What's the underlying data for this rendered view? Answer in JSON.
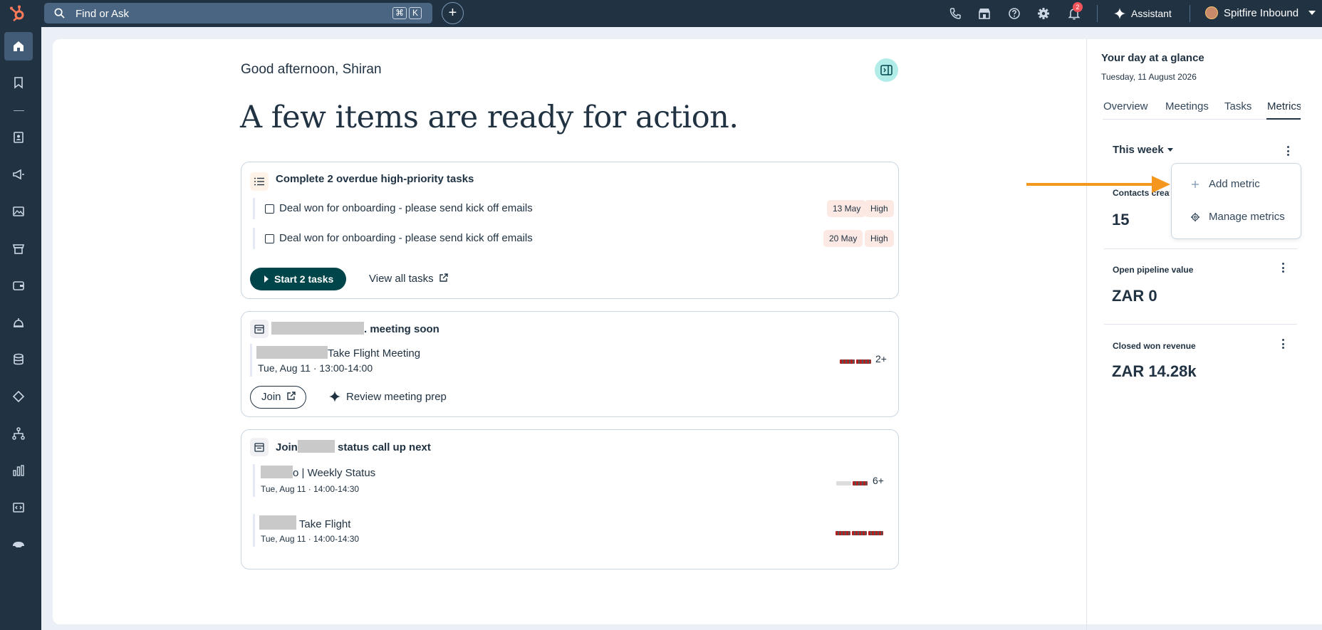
{
  "topbar": {
    "search_placeholder": "Find or Ask",
    "shortcut_keys": [
      "⌘",
      "K"
    ],
    "notification_count": "2",
    "assistant_label": "Assistant",
    "account_name": "Spitfire Inbound"
  },
  "main": {
    "greeting": "Good afternoon, Shiran",
    "headline": "A few items are ready for action.",
    "tasks_card": {
      "title": "Complete 2 overdue high-priority tasks",
      "tasks": [
        {
          "text": "Deal won for onboarding - please send kick off emails",
          "date": "13 May",
          "priority": "High"
        },
        {
          "text": "Deal won for onboarding - please send kick off emails",
          "date": "20 May",
          "priority": "High"
        }
      ],
      "start_label": "Start 2 tasks",
      "view_all_label": "View all tasks"
    },
    "meeting_card": {
      "title_suffix": ". meeting soon",
      "meeting_title": "Take Flight Meeting",
      "meeting_time": "Tue, Aug 11 · 13:00-14:00",
      "attendee_more": "2+",
      "join_label": "Join",
      "prep_label": "Review meeting prep"
    },
    "call_card": {
      "title_prefix": "Join",
      "title_suffix": " status call up next",
      "meetings": [
        {
          "title": "o | Weekly Status",
          "time": "Tue, Aug 11 · 14:00-14:30",
          "more": "6+"
        },
        {
          "title": " Take Flight",
          "time": "Tue, Aug 11 · 14:00-14:30",
          "more": ""
        }
      ]
    }
  },
  "sidebar": {
    "title": "Your day at a glance",
    "date": "Tuesday, 11 August 2026",
    "tabs": [
      "Overview",
      "Meetings",
      "Tasks",
      "Metrics"
    ],
    "active_tab": "Metrics",
    "period": "This week",
    "metrics": [
      {
        "label": "Contacts creat",
        "value": "15"
      },
      {
        "label": "Open pipeline value",
        "value": "ZAR 0"
      },
      {
        "label": "Closed won revenue",
        "value": "ZAR 14.28k"
      }
    ],
    "menu": {
      "add_metric": "Add metric",
      "manage_metrics": "Manage metrics"
    }
  },
  "colors": {
    "topbar_bg": "#213343",
    "primary_button": "#00454a",
    "annotation_arrow": "#f5971f",
    "priority_pill": "#fde9e4"
  }
}
